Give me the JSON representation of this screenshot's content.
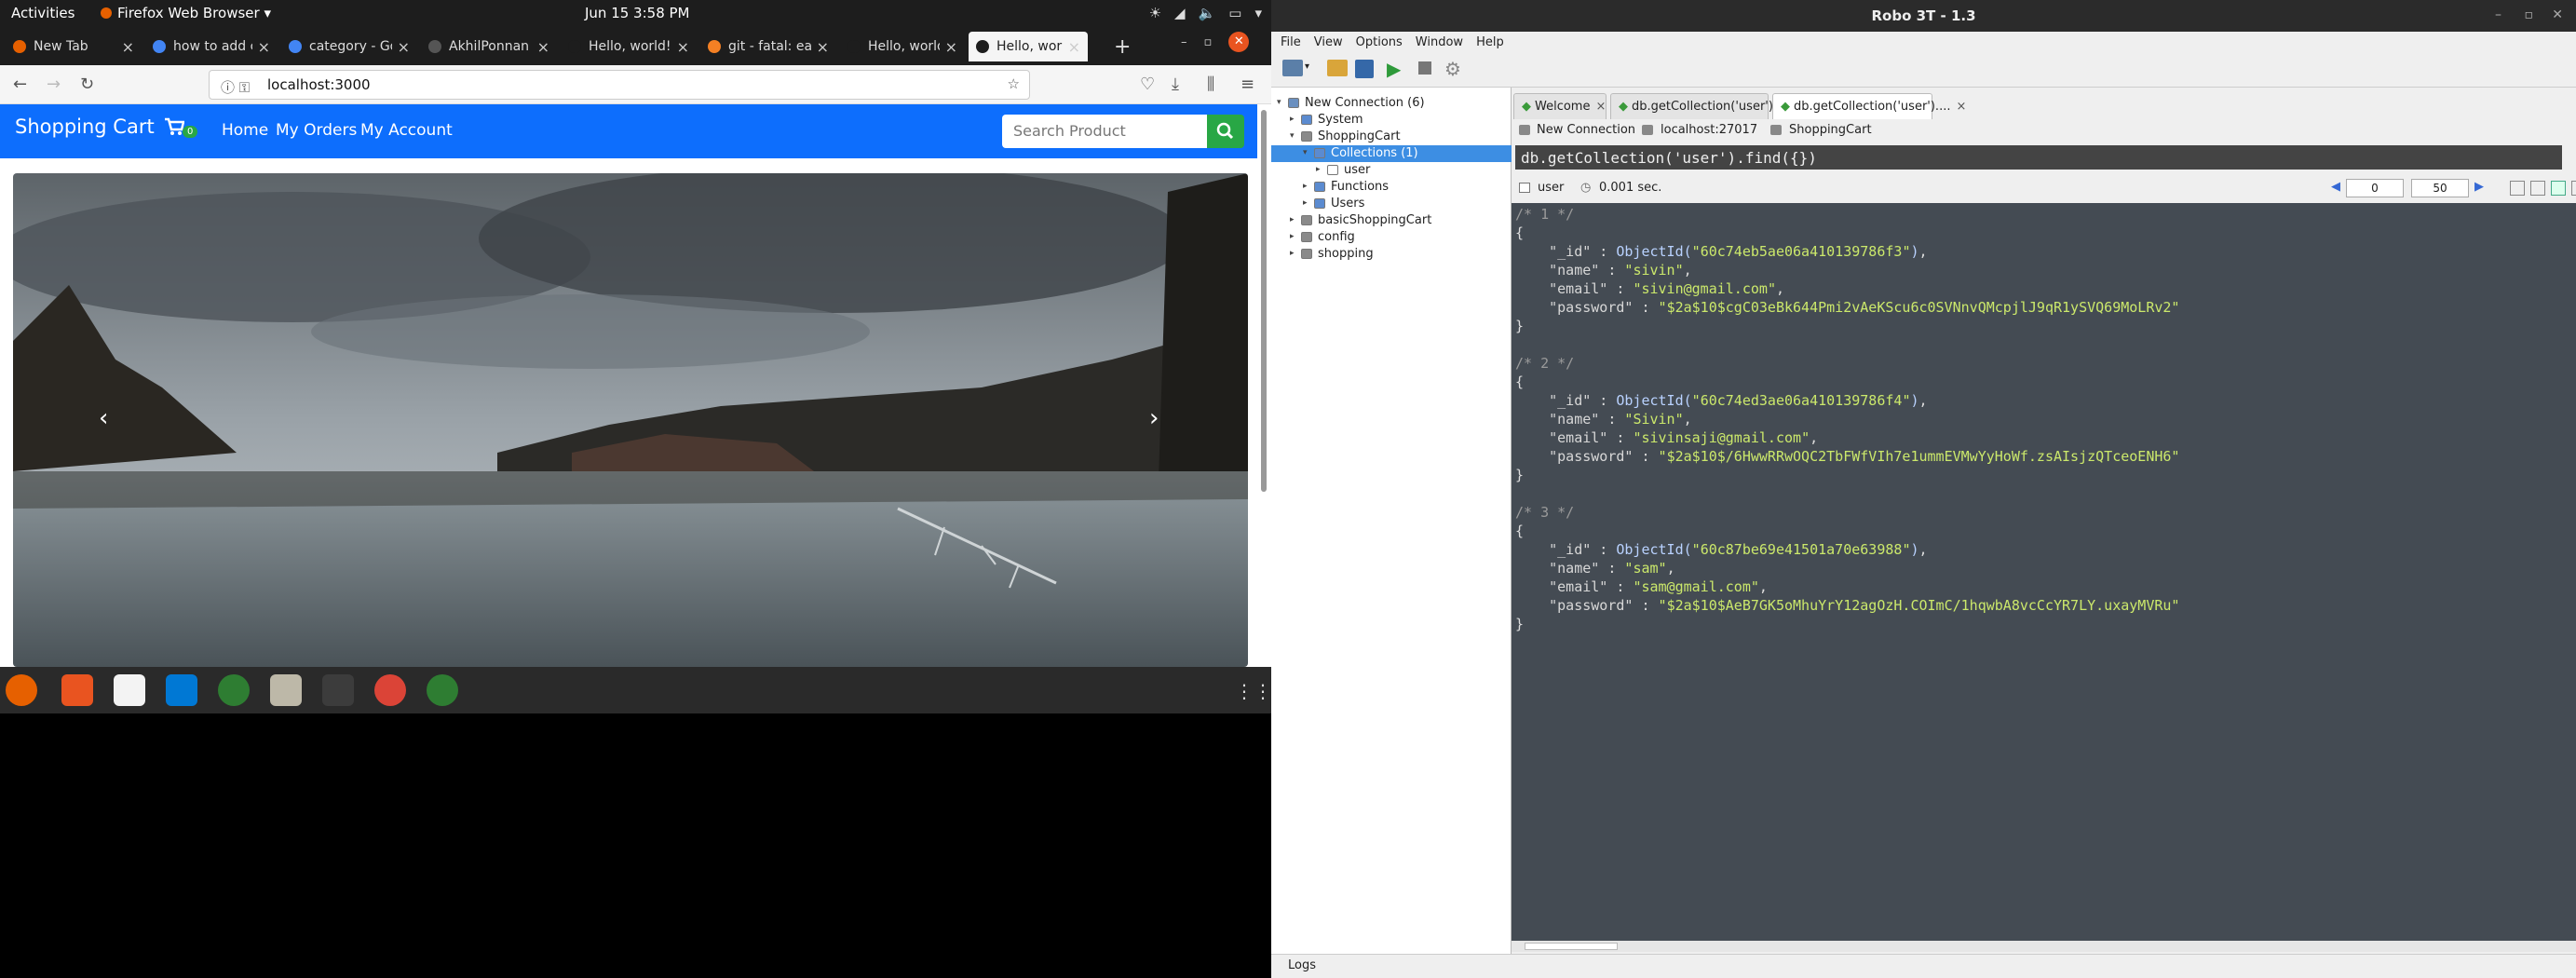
{
  "system": {
    "activities": "Activities",
    "app_menu": "Firefox Web Browser",
    "clock": "Jun 15  3:58 PM"
  },
  "firefox": {
    "tabs": [
      {
        "label": "New Tab",
        "color": "#e66000"
      },
      {
        "label": "how to add c",
        "color": "#4285f4"
      },
      {
        "label": "category - Go",
        "color": "#4285f4"
      },
      {
        "label": "AkhilPonnan",
        "color": "#555555"
      },
      {
        "label": "Hello, world!",
        "color": "#1d1d1d"
      },
      {
        "label": "git - fatal: ear",
        "color": "#f48024"
      },
      {
        "label": "Hello, world!",
        "color": "#1d1d1d"
      },
      {
        "label": "Hello, world!",
        "color": "#1d1d1d"
      }
    ],
    "url": "localhost:3000"
  },
  "page": {
    "brand": "Shopping Cart",
    "cart_count": "0",
    "nav": [
      "Home",
      "My Orders",
      "My Account"
    ],
    "search_placeholder": "Search Product",
    "nav_color": "#0d6efd",
    "search_btn_color": "#28a745"
  },
  "dock": {
    "apps": [
      "firefox-icon",
      "software-icon",
      "text-editor-icon",
      "vscode-icon",
      "robo3t-icon",
      "files-icon",
      "terminal-icon",
      "chrome-icon",
      "robo3t-icon"
    ]
  },
  "robo": {
    "title": "Robo 3T - 1.3",
    "menu": [
      "File",
      "View",
      "Options",
      "Window",
      "Help"
    ],
    "tree": [
      {
        "label": "New Connection (6)",
        "level": 0,
        "arrow": "▾",
        "icon": "connection"
      },
      {
        "label": "System",
        "level": 1,
        "arrow": "▸",
        "icon": "folder"
      },
      {
        "label": "ShoppingCart",
        "level": 1,
        "arrow": "▾",
        "icon": "db"
      },
      {
        "label": "Collections (1)",
        "level": 2,
        "arrow": "▾",
        "icon": "folder",
        "selected": true
      },
      {
        "label": "user",
        "level": 3,
        "arrow": "▸",
        "icon": "collection"
      },
      {
        "label": "Functions",
        "level": 2,
        "arrow": "▸",
        "icon": "folder"
      },
      {
        "label": "Users",
        "level": 2,
        "arrow": "▸",
        "icon": "folder"
      },
      {
        "label": "basicShoppingCart",
        "level": 1,
        "arrow": "▸",
        "icon": "db"
      },
      {
        "label": "config",
        "level": 1,
        "arrow": "▸",
        "icon": "db"
      },
      {
        "label": "shopping",
        "level": 1,
        "arrow": "▸",
        "icon": "db"
      }
    ],
    "tabs": [
      "Welcome",
      "db.getCollection('user')....",
      "db.getCollection('user')...."
    ],
    "conn_info": {
      "connection": "New Connection",
      "host": "localhost:27017",
      "db": "ShoppingCart"
    },
    "query": "db.getCollection('user').find({})",
    "result_collection": "user",
    "result_time": "0.001 sec.",
    "page_from": "0",
    "page_size": "50",
    "documents": [
      {
        "comment": "/* 1 */",
        "id": "60c74eb5ae06a410139786f3",
        "name": "sivin",
        "email": "sivin@gmail.com",
        "password": "$2a$10$cgC03eBk644Pmi2vAeKScu6c0SVNnvQMcpjlJ9qR1ySVQ69MoLRv2"
      },
      {
        "comment": "/* 2 */",
        "id": "60c74ed3ae06a410139786f4",
        "name": "Sivin",
        "email": "sivinsaji@gmail.com",
        "password": "$2a$10$/6HwwRRwOQC2TbFWfVIh7e1ummEVMwYyHoWf.zsAIsjzQTceoENH6"
      },
      {
        "comment": "/* 3 */",
        "id": "60c87be69e41501a70e63988",
        "name": "sam",
        "email": "sam@gmail.com",
        "password": "$2a$10$AeB7GK5oMhuYrY12agOzH.COImC/1hqwbA8vcCcYR7LY.uxayMVRu"
      }
    ],
    "logs": "Logs"
  }
}
